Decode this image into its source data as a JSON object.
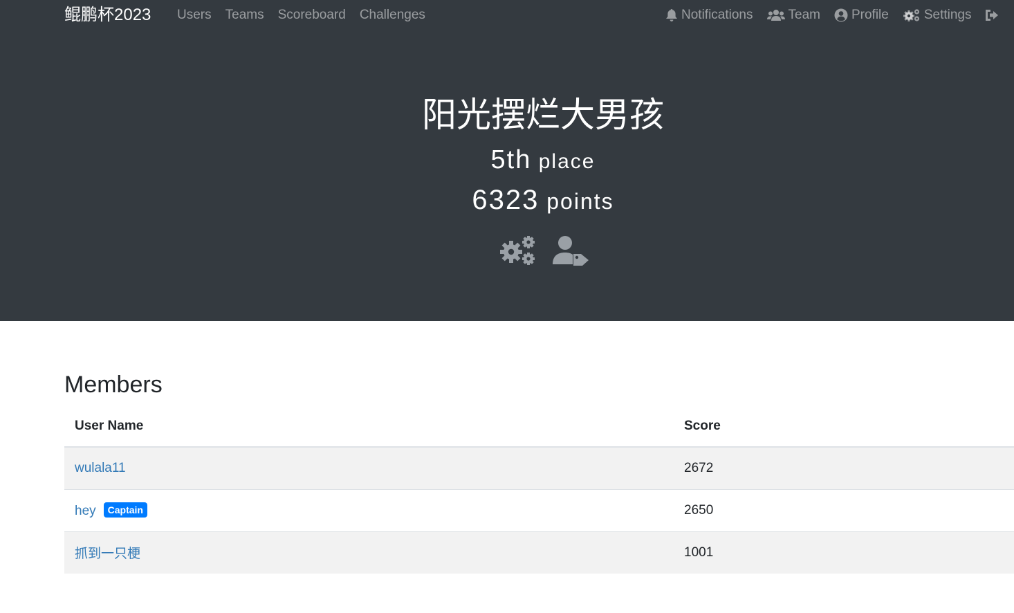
{
  "navbar": {
    "brand": "鲲鹏杯2023",
    "links": [
      "Users",
      "Teams",
      "Scoreboard",
      "Challenges"
    ],
    "right": {
      "notifications": {
        "label": "Notifications",
        "icon": "bell-icon"
      },
      "team": {
        "label": "Team",
        "icon": "users-icon"
      },
      "profile": {
        "label": "Profile",
        "icon": "user-circle-icon"
      },
      "settings": {
        "label": "Settings",
        "icon": "cogs-icon"
      },
      "logout": {
        "icon": "sign-out-icon"
      }
    }
  },
  "team": {
    "name": "阳光摆烂大男孩",
    "place_number": "5th",
    "place_label": "place",
    "points_number": "6323",
    "points_label": "points",
    "action_icons": [
      "cogs-icon",
      "user-tag-icon"
    ]
  },
  "members": {
    "title": "Members",
    "columns": [
      "User Name",
      "Score"
    ],
    "rows": [
      {
        "name": "wulala11",
        "score": "2672",
        "badge": ""
      },
      {
        "name": "hey",
        "score": "2650",
        "badge": "Captain"
      },
      {
        "name": "抓到一只梗",
        "score": "1001",
        "badge": ""
      }
    ]
  },
  "colors": {
    "navbar_bg": "#343a40",
    "link": "#337ab7",
    "badge": "#007bff",
    "stripe": "#f2f2f2"
  }
}
